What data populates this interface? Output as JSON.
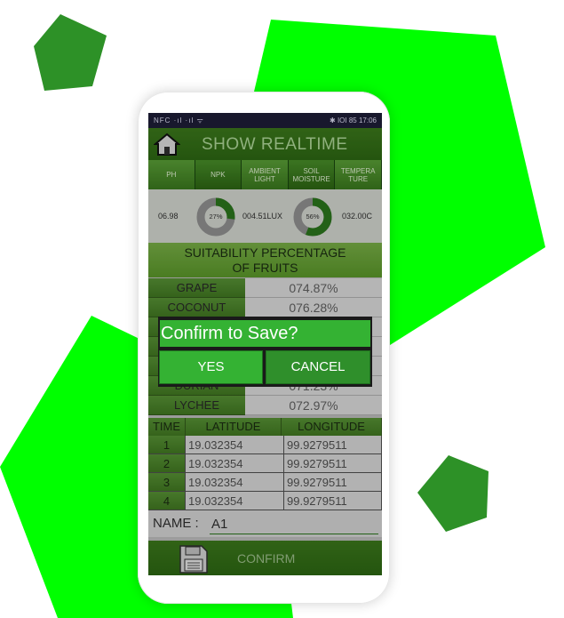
{
  "status_bar": {
    "left": "NFC ·ıl ·ıl ᯤ",
    "right": "✱ IOI 85 17:06"
  },
  "header": {
    "title": "SHOW REALTIME"
  },
  "sensors": [
    "PH",
    "NPK",
    "AMBIENT LIGHT",
    "SOIL MOISTURE",
    "TEMPERA TURE"
  ],
  "readings": {
    "ph": "06.98",
    "npk_pct": "27%",
    "npk_fraction": 0.27,
    "light": "004.51LUX",
    "moisture_pct": "56%",
    "moisture_fraction": 0.56,
    "temperature": "032.00C"
  },
  "suitability": {
    "title_line1": "SUITABILITY PERCENTAGE",
    "title_line2": "OF FRUITS"
  },
  "fruits": [
    {
      "name": "GRAPE",
      "pct": "074.87%"
    },
    {
      "name": "COCONUT",
      "pct": "076.28%"
    },
    {
      "name": "",
      "pct": ""
    },
    {
      "name": "",
      "pct": ""
    },
    {
      "name": "",
      "pct": ""
    },
    {
      "name": "DURIAN",
      "pct": "071.23%"
    },
    {
      "name": "LYCHEE",
      "pct": "072.97%"
    }
  ],
  "gps": {
    "headers": [
      "TIME",
      "LATITUDE",
      "LONGITUDE"
    ],
    "rows": [
      [
        "1",
        "19.032354",
        "99.9279511"
      ],
      [
        "2",
        "19.032354",
        "99.9279511"
      ],
      [
        "3",
        "19.032354",
        "99.9279511"
      ],
      [
        "4",
        "19.032354",
        "99.9279511"
      ]
    ]
  },
  "name_field": {
    "label": "NAME :",
    "value": "A1"
  },
  "confirm_button": {
    "label": "CONFIRM"
  },
  "dialog": {
    "title": "Confirm to Save?",
    "yes": "YES",
    "cancel": "CANCEL"
  },
  "colors": {
    "bright_green": "#00ff00",
    "dark_green": "#2e8b22",
    "app_green": "#3f7f1d",
    "dialog_green": "#34b233"
  },
  "icons": [
    "home-icon",
    "save-disk-icon"
  ]
}
